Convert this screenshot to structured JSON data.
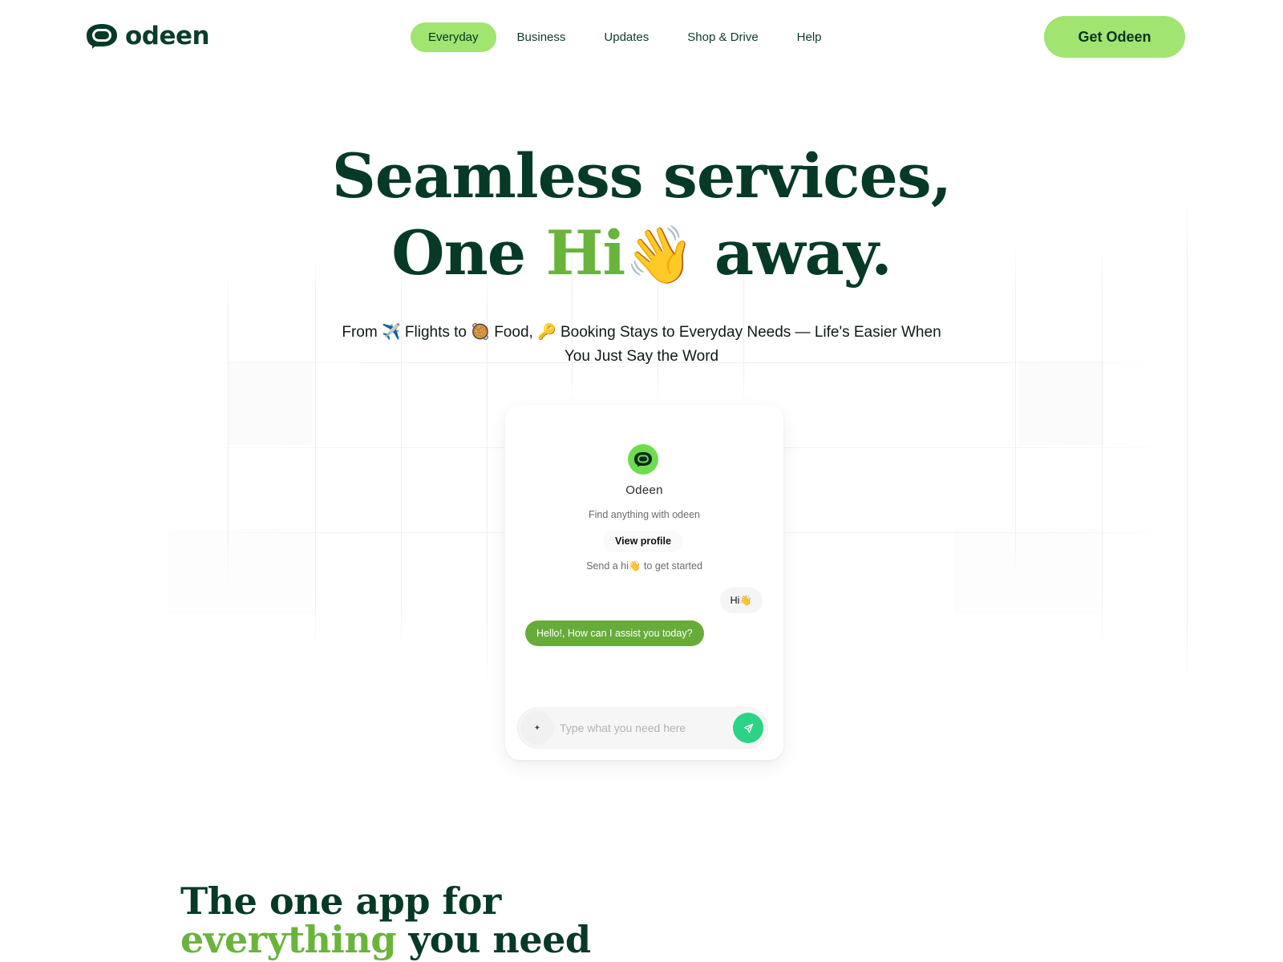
{
  "brand": {
    "name": "odeen",
    "logo_icon": "chat-bubble-logo-icon",
    "colors": {
      "dark_green": "#063a27",
      "lime": "#a1e46f",
      "accent_green": "#69b43a",
      "bot_bubble": "#67ac3a",
      "send_button": "#2bd485",
      "avatar_bg": "#6fdc4f"
    }
  },
  "nav": {
    "items": [
      {
        "label": "Everyday",
        "active": true
      },
      {
        "label": "Business",
        "active": false
      },
      {
        "label": "Updates",
        "active": false
      },
      {
        "label": "Shop & Drive",
        "active": false
      },
      {
        "label": "Help",
        "active": false
      }
    ],
    "cta_label": "Get Odeen"
  },
  "hero": {
    "title_line1": "Seamless services,",
    "title_line2_before": "One ",
    "title_line2_accent": "Hi",
    "title_line2_emoji": "👋",
    "title_line2_after": " away.",
    "subtitle_line1": "From ✈️ Flights to 🥘 Food, 🔑 Booking Stays to Everyday Needs — Life's Easier When",
    "subtitle_line2": "You Just Say the Word"
  },
  "chat_card": {
    "avatar_icon": "odeen-logo-icon",
    "name": "Odeen",
    "description": "Find anything with odeen",
    "view_profile_label": "View profile",
    "hint": "Send a hi👋 to get started",
    "messages": [
      {
        "from": "user",
        "text": "Hi👋"
      },
      {
        "from": "bot",
        "text": "Hello!, How can I assist you today?"
      }
    ],
    "composer": {
      "placeholder": "Type what you need here",
      "value": "",
      "attach_icon": "sparkle-icon",
      "send_icon": "paper-plane-icon"
    }
  },
  "section2": {
    "title_line1": "The one app for",
    "title_line2_accent": "everything",
    "title_line2_after": " you need"
  }
}
